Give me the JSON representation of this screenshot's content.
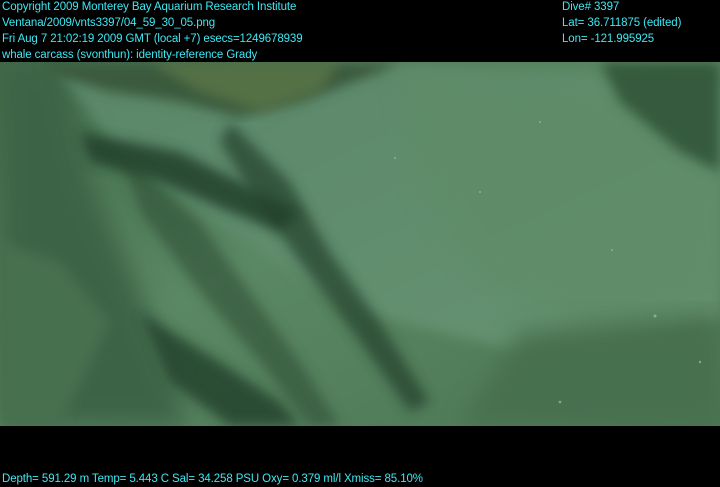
{
  "overlay": {
    "header_left": [
      "Copyright 2009 Monterey Bay Aquarium Research Institute",
      "Ventana/2009/vnts3397/04_59_30_05.png",
      "Fri Aug  7 21:02:19 2009 GMT (local +7)  esecs=1249678939",
      "whale carcass (svonthun): identity-reference Grady"
    ],
    "header_right": [
      "Dive# 3397",
      "Lat= 36.711875 (edited)",
      "Lon= -121.995925"
    ],
    "footer": "Depth= 591.29 m  Temp= 5.443 C  Sal= 34.258 PSU  Oxy= 0.379 ml/l  Xmiss= 85.10%"
  },
  "colors": {
    "overlay_text": "#3ee8f2",
    "water": "#4f7a58",
    "letterbox": "#000000"
  }
}
